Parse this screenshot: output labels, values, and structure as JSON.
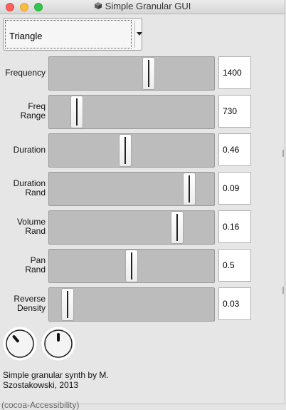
{
  "window": {
    "title": "Simple Granular GUI",
    "icon": "app-cube-icon"
  },
  "waveform": {
    "selected": "Triangle",
    "icon": "chevron-down-icon"
  },
  "sliders": [
    {
      "id": "frequency",
      "label_lines": [
        "Frequency"
      ],
      "value": "1400",
      "fraction": 0.61
    },
    {
      "id": "freq-range",
      "label_lines": [
        "Freq",
        "Range"
      ],
      "value": "730",
      "fraction": 0.14
    },
    {
      "id": "duration",
      "label_lines": [
        "Duration"
      ],
      "value": "0.46",
      "fraction": 0.46
    },
    {
      "id": "duration-rand",
      "label_lines": [
        "Duration",
        "Rand"
      ],
      "value": "0.09",
      "fraction": 0.88
    },
    {
      "id": "volume-rand",
      "label_lines": [
        "Volume",
        "Rand"
      ],
      "value": "0.16",
      "fraction": 0.8
    },
    {
      "id": "pan-rand",
      "label_lines": [
        "Pan",
        "Rand"
      ],
      "value": "0.5",
      "fraction": 0.5
    },
    {
      "id": "reverse-density",
      "label_lines": [
        "Reverse",
        "Density"
      ],
      "value": "0.03",
      "fraction": 0.08
    }
  ],
  "knobs": [
    {
      "id": "knob-left",
      "level": 0.35
    },
    {
      "id": "knob-right",
      "level": 0.5
    }
  ],
  "footer": {
    "line1": "Simple granular synth by M.",
    "line2": "Szostakowski, 2013"
  },
  "underlying_window_text": "(cocoa-Accessibility)"
}
